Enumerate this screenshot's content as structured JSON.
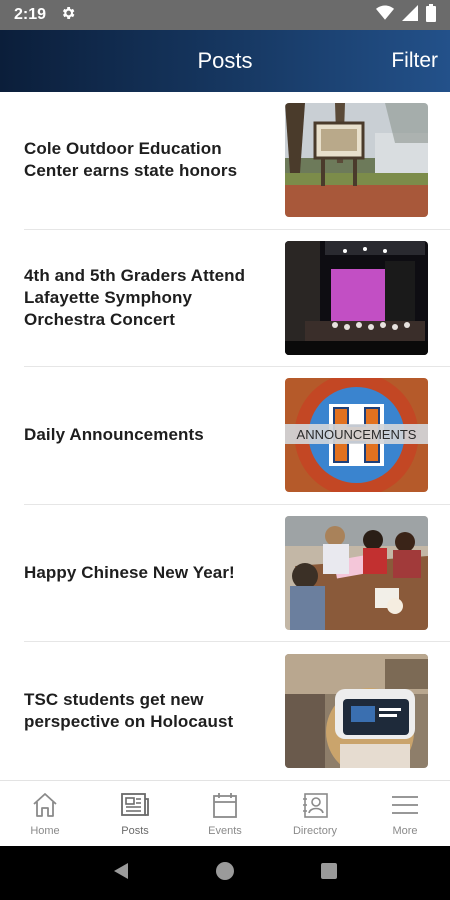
{
  "status_bar": {
    "time": "2:19",
    "icons": [
      "gear-icon",
      "wifi-icon",
      "signal-icon",
      "battery-icon"
    ]
  },
  "header": {
    "title": "Posts",
    "filter_label": "Filter"
  },
  "posts": [
    {
      "title": "Cole Outdoor Education Center earns state honors",
      "thumbnail": "outdoor-sign-photo"
    },
    {
      "title": "4th and 5th Graders Attend Lafayette Symphony Orchestra Concert",
      "thumbnail": "orchestra-concert-photo"
    },
    {
      "title": "Daily Announcements",
      "thumbnail": "announcements-graphic",
      "thumbnail_text": "ANNOUNCEMENTS"
    },
    {
      "title": "Happy Chinese New Year!",
      "thumbnail": "students-table-photo"
    },
    {
      "title": "TSC students get new perspective on Holocaust",
      "thumbnail": "vr-headset-photo"
    }
  ],
  "bottom_nav": [
    {
      "label": "Home",
      "icon": "home-icon"
    },
    {
      "label": "Posts",
      "icon": "newspaper-icon",
      "active": true
    },
    {
      "label": "Events",
      "icon": "calendar-icon"
    },
    {
      "label": "Directory",
      "icon": "contact-card-icon"
    },
    {
      "label": "More",
      "icon": "menu-icon"
    }
  ],
  "colors": {
    "header_start": "#0b1e3a",
    "header_end": "#23518a",
    "status_bar": "#6b6b6b"
  }
}
